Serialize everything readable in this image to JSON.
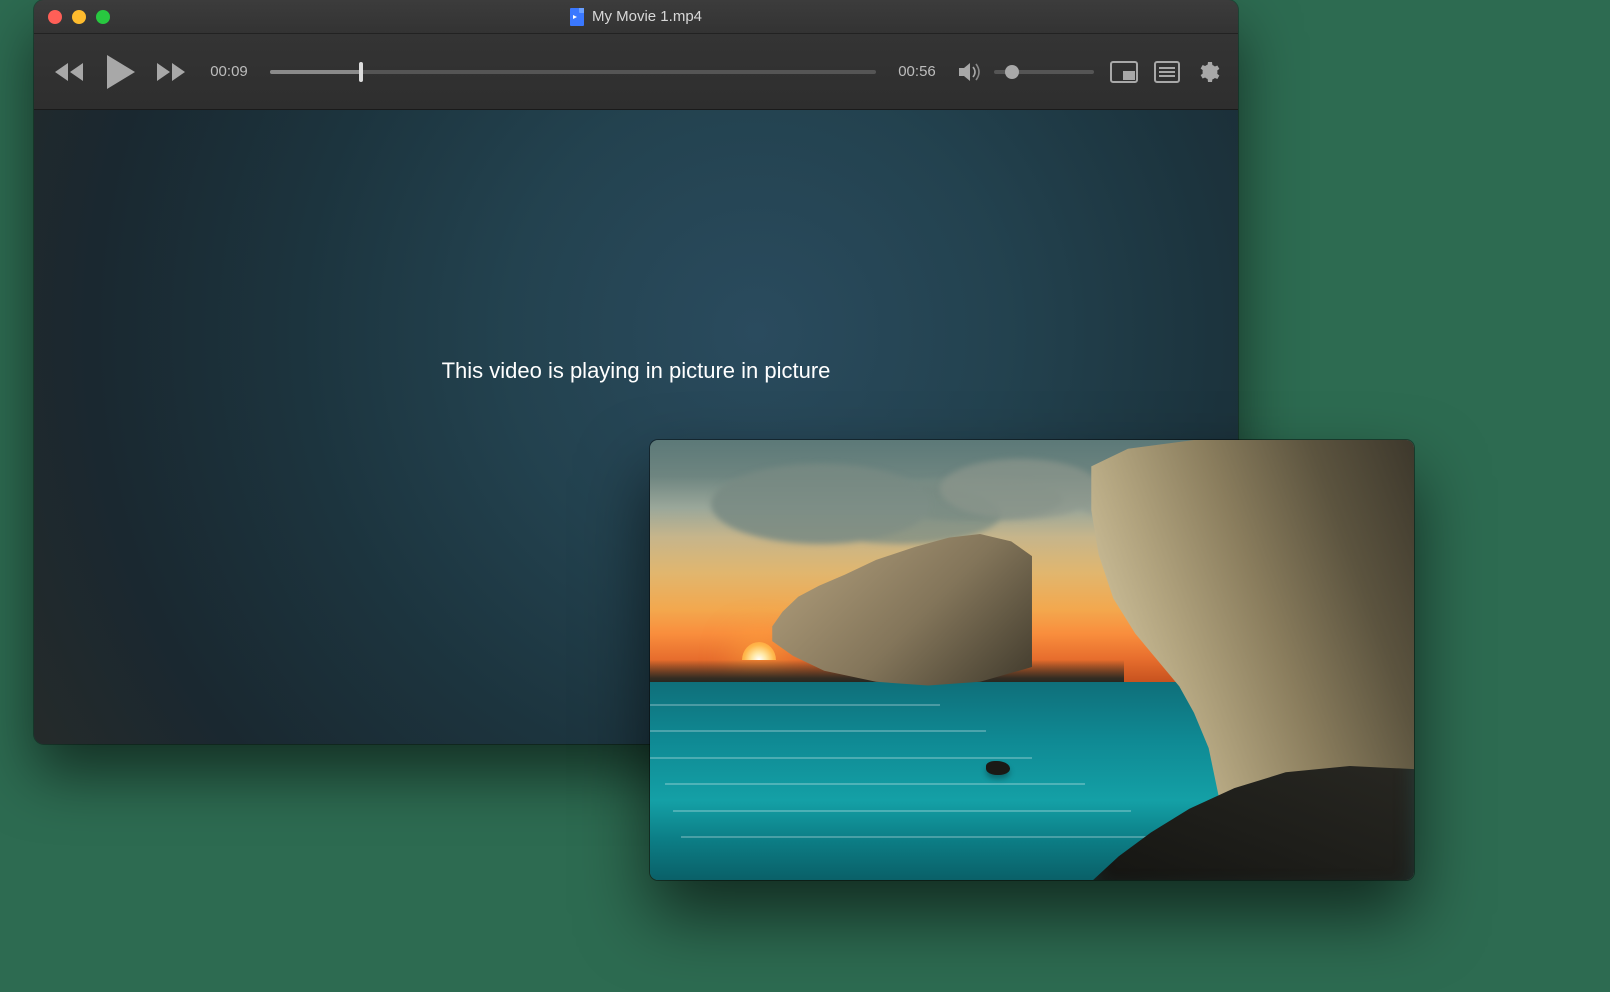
{
  "window": {
    "title": "My Movie 1.mp4"
  },
  "playback": {
    "current_time": "00:09",
    "total_time": "00:56",
    "progress_percent": 15,
    "volume_percent": 18
  },
  "message": {
    "pip": "This video is playing in picture in picture"
  },
  "icons": {
    "rewind": "rewind-icon",
    "play": "play-icon",
    "forward": "fast-forward-icon",
    "volume": "speaker-icon",
    "pip": "picture-in-picture-icon",
    "playlist": "playlist-icon",
    "settings": "gear-icon"
  }
}
